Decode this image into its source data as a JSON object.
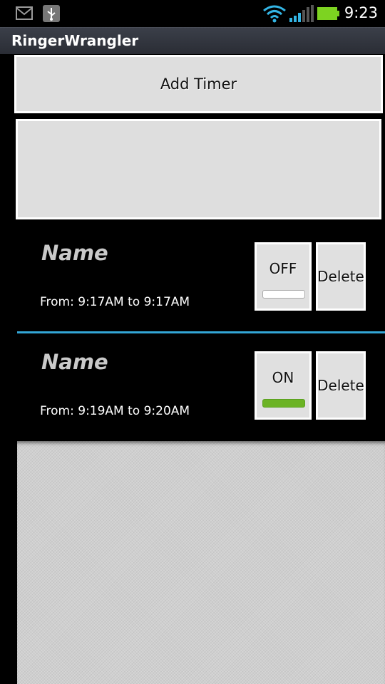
{
  "status_bar": {
    "time": "9:23",
    "icons": [
      "gmail-icon",
      "usb-icon",
      "wifi-icon",
      "signal-icon",
      "battery-icon"
    ],
    "battery_color": "#7dd321",
    "wifi_color": "#33b5e5"
  },
  "app": {
    "title": "RingerWrangler"
  },
  "add_timer": {
    "label": "Add Timer"
  },
  "timers": [
    {
      "name": "Name",
      "range": "From: 9:17AM to 9:17AM",
      "toggle": "OFF",
      "enabled": false,
      "delete_label": "Delete"
    },
    {
      "name": "Name",
      "range": "From: 9:19AM to 9:20AM",
      "toggle": "ON",
      "enabled": true,
      "delete_label": "Delete"
    }
  ],
  "colors": {
    "divider": "#33a6d6",
    "toggle_on": "#6bb324"
  }
}
